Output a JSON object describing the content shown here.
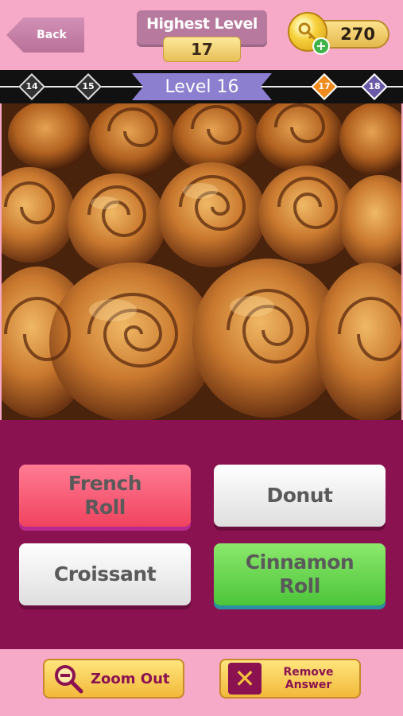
{
  "header": {
    "back_label": "Back",
    "highest_level_label": "Highest Level",
    "highest_level_value": "17",
    "coins": "270"
  },
  "levels": {
    "prev2": "14",
    "prev1": "15",
    "current": "Level 16",
    "next1": "17",
    "next2": "18"
  },
  "answers": {
    "a1_line1": "French",
    "a1_line2": "Roll",
    "a2": "Donut",
    "a3": "Croissant",
    "a4_line1": "Cinnamon",
    "a4_line2": "Roll"
  },
  "footer": {
    "zoom_label": "Zoom Out",
    "remove_line1": "Remove",
    "remove_line2": "Answer"
  },
  "colors": {
    "background": "#f7a9c8",
    "panel": "#8b1250",
    "current_level": "#8c7fd0",
    "next_level": "#f08a1c"
  }
}
